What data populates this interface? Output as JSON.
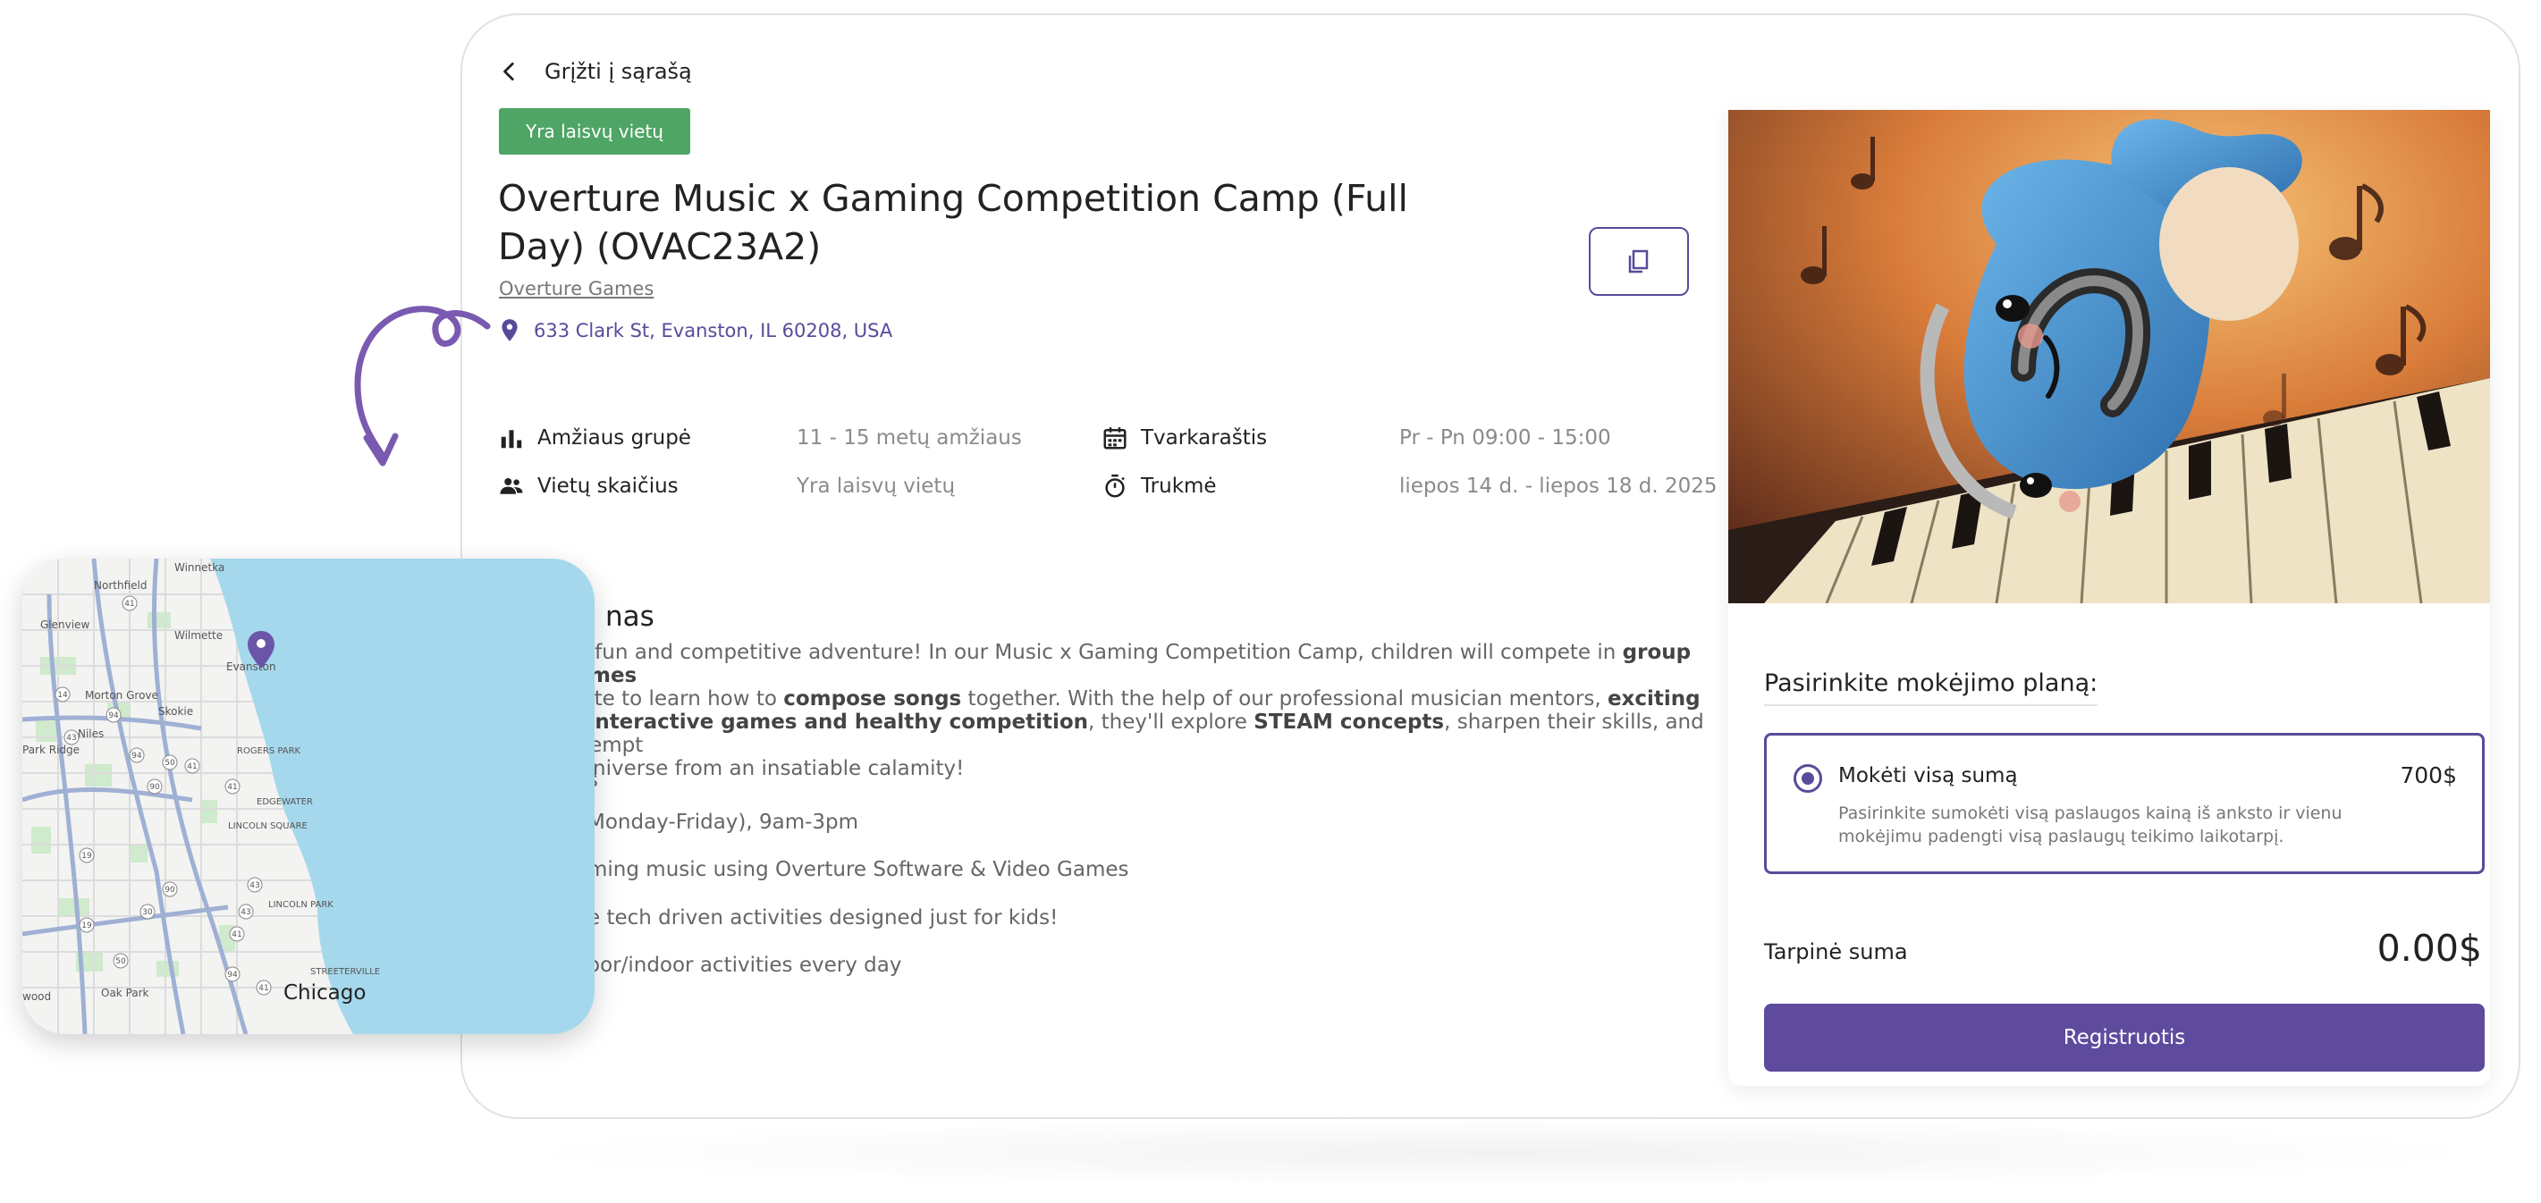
{
  "back": {
    "label": "Grįžti į sąrašą"
  },
  "badge": "Yra laisvų vietų",
  "title": "Overture Music x Gaming Competition Camp (Full Day) (OVAC23A2)",
  "organizer": "Overture Games",
  "location": "633 Clark St, Evanston, IL 60208, USA",
  "info": {
    "age_label": "Amžiaus grupė",
    "age_value": "11 - 15 metų amžiaus",
    "seats_label": "Vietų skaičius",
    "seats_value": "Yra laisvų vietų",
    "schedule_label": "Tvarkaraštis",
    "schedule_value": "Pr - Pn 09:00 - 15:00",
    "duration_label": "Trukmė",
    "duration_value": "liepos 14 d. - liepos 18 d. 2025"
  },
  "description": {
    "title": "nas",
    "line1_a": "r a fun and competitive adventure! In our Music x Gaming Competition Camp, children will compete in ",
    "line1_b": "group games",
    "line2_a": "orate to learn how to ",
    "line2_b": "compose songs",
    "line2_c": " together. With the help of our professional musician mentors, ",
    "line2_d": "exciting",
    "line3_a": "s, interactive games and healthy competition",
    "line3_b": ", they'll explore ",
    "line3_c": "STEAM concepts",
    "line3_d": ", sharpen their skills, and attempt",
    "line4": "e universe from an insatiable calamity!",
    "sub_title": "s",
    "bullets": [
      "Monday-Friday), 9am-3pm",
      "ming music using Overture Software & Video Games",
      "e tech driven activities designed just for kids!",
      "oor/indoor activities every day"
    ]
  },
  "payment": {
    "title": "Pasirinkite mokėjimo planą:",
    "option_name": "Mokėti visą sumą",
    "option_price": "700$",
    "option_desc": "Pasirinkite sumokėti visą paslaugos kainą iš anksto ir vienu mokėjimu padengti visą paslaugų teikimo laikotarpį.",
    "subtotal_label": "Tarpinė suma",
    "subtotal_value": "0.00$",
    "register": "Registruotis"
  },
  "map": {
    "city": "Chicago",
    "labels": [
      "Winnetka",
      "Northfield",
      "Wilmette",
      "Glenview",
      "Skokie",
      "Morton Grove",
      "Evanston",
      "Niles",
      "Park Ridge",
      "ROGERS PARK",
      "EDGEWATER",
      "LINCOLN SQUARE",
      "LINCOLN PARK",
      "STREETERVILLE",
      "Oak Park",
      "wood"
    ],
    "shields": [
      "41",
      "14",
      "94",
      "43",
      "50",
      "90",
      "41",
      "19",
      "94",
      "90",
      "41",
      "43",
      "41",
      "43",
      "50",
      "30",
      "94",
      "19",
      "41"
    ]
  },
  "colors": {
    "accent": "#5e4b9e",
    "badge": "#4fa565",
    "water": "#a5d8ec"
  }
}
